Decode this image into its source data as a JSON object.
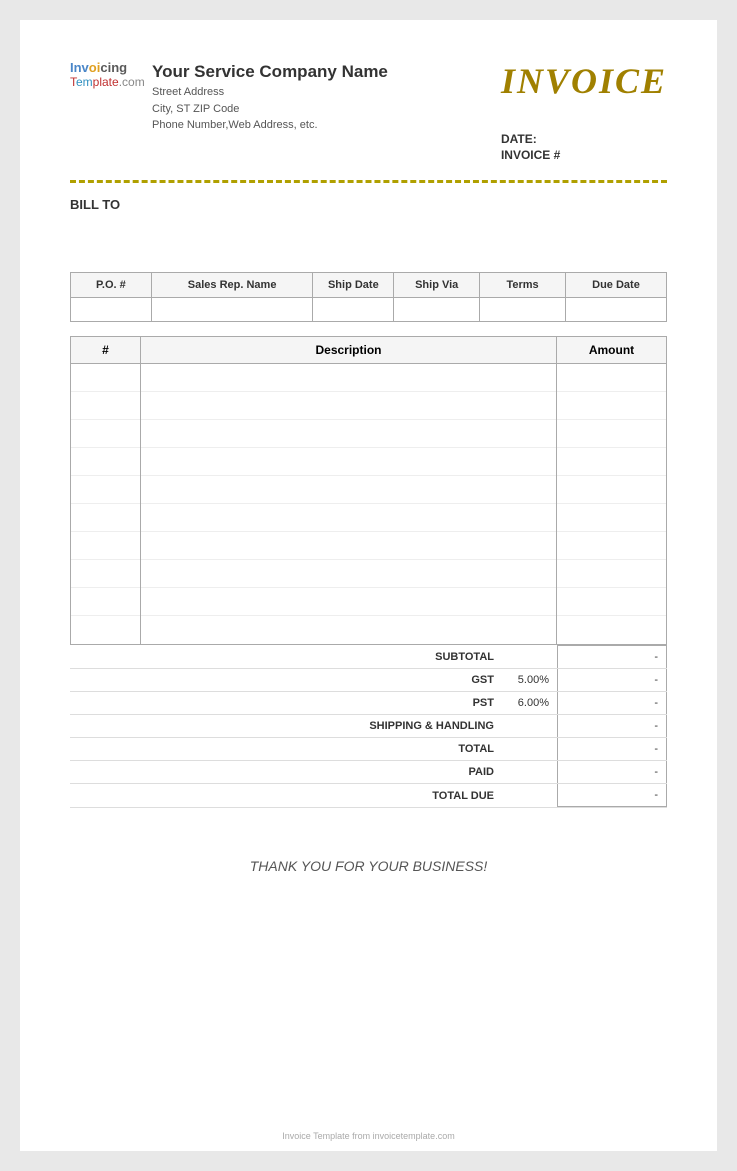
{
  "header": {
    "invoice_title": "INVOICE",
    "company_name": "Your Service Company Name",
    "street_address": "Street Address",
    "city_state_zip": "City, ST  ZIP Code",
    "phone_web": "Phone Number,Web Address, etc.",
    "date_label": "DATE:",
    "invoice_num_label": "INVOICE #",
    "logo_invoicing_1": "Invoicing",
    "logo_template_1": "Template.com"
  },
  "bill_to": {
    "label": "BILL TO"
  },
  "order_table": {
    "headers": [
      "P.O. #",
      "Sales Rep. Name",
      "Ship Date",
      "Ship Via",
      "Terms",
      "Due Date"
    ]
  },
  "items_table": {
    "headers": [
      "#",
      "Description",
      "Amount"
    ]
  },
  "totals": {
    "subtotal_label": "SUBTOTAL",
    "gst_label": "GST",
    "gst_rate": "5.00%",
    "pst_label": "PST",
    "pst_rate": "6.00%",
    "shipping_label": "SHIPPING & HANDLING",
    "total_label": "TOTAL",
    "paid_label": "PAID",
    "total_due_label": "TOTAL DUE",
    "dash": "-"
  },
  "footer": {
    "thank_you": "THANK YOU FOR YOUR BUSINESS!",
    "watermark": "Invoice Template from invoicetemplate.com"
  }
}
